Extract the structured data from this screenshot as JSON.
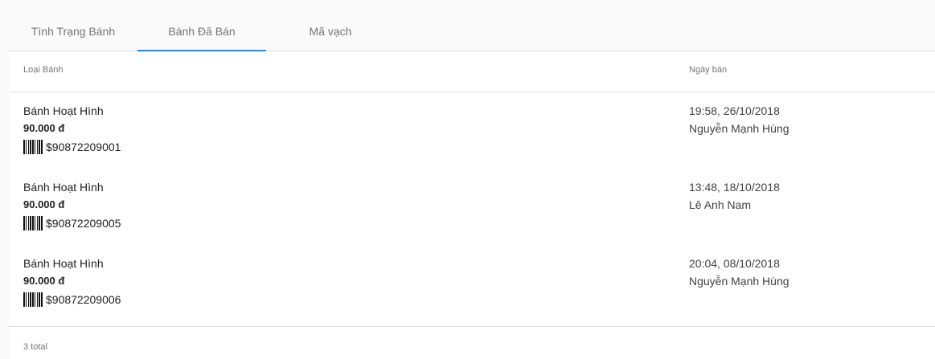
{
  "tabs": [
    {
      "label": "Tình Trạng Bánh",
      "active": false
    },
    {
      "label": "Bánh Đã Bán",
      "active": true
    },
    {
      "label": "Mã vạch",
      "active": false
    }
  ],
  "table": {
    "headers": {
      "type": "Loại Bánh",
      "date": "Ngày bán"
    },
    "rows": [
      {
        "name": "Bánh Hoạt Hình",
        "price": "90.000 đ",
        "code": "$90872209001",
        "time": "19:58, 26/10/2018",
        "seller": "Nguyễn Mạnh Hùng"
      },
      {
        "name": "Bánh Hoạt Hình",
        "price": "90.000 đ",
        "code": "$90872209005",
        "time": "13:48, 18/10/2018",
        "seller": "Lê Anh Nam"
      },
      {
        "name": "Bánh Hoạt Hình",
        "price": "90.000 đ",
        "code": "$90872209006",
        "time": "20:04, 08/10/2018",
        "seller": "Nguyễn Mạnh Hùng"
      }
    ],
    "total": "3 total"
  },
  "icons": {
    "barcode": "barcode-icon"
  },
  "colors": {
    "accent": "#2e86de"
  }
}
